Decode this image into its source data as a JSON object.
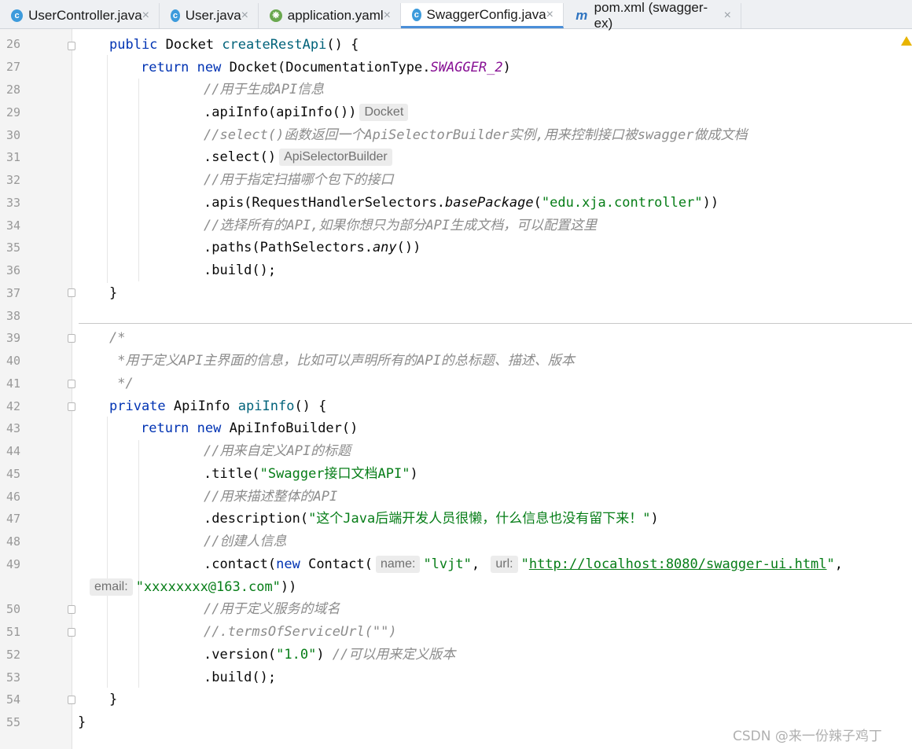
{
  "tabs": [
    {
      "label": "UserController.java",
      "icon": "java-class-icon",
      "close": "×"
    },
    {
      "label": "User.java",
      "icon": "java-class-icon",
      "close": "×"
    },
    {
      "label": "application.yaml",
      "icon": "spring-yaml-icon",
      "close": "×"
    },
    {
      "label": "SwaggerConfig.java",
      "icon": "java-class-icon",
      "close": "×",
      "active": true
    },
    {
      "label": "pom.xml (swagger-ex)",
      "icon": "maven-icon",
      "close": "×"
    }
  ],
  "line_numbers": [
    "26",
    "27",
    "28",
    "29",
    "30",
    "31",
    "32",
    "33",
    "34",
    "35",
    "36",
    "37",
    "38",
    "39",
    "40",
    "41",
    "42",
    "43",
    "44",
    "45",
    "46",
    "47",
    "48",
    "49",
    "50",
    "51",
    "52",
    "53",
    "54",
    "55"
  ],
  "code": {
    "l26": {
      "kw": "public ",
      "type": "Docket ",
      "fn": "createRestApi",
      "rest": "() {"
    },
    "l27": {
      "kw1": "return ",
      "kw2": "new ",
      "a": "Docket(DocumentationType.",
      "const": "SWAGGER_2",
      "b": ")"
    },
    "l28": {
      "comment": "//用于生成API信息"
    },
    "l29": {
      "code": ".apiInfo(apiInfo())",
      "hint": "Docket"
    },
    "l30": {
      "comment": "//select()函数返回一个ApiSelectorBuilder实例,用来控制接口被swagger做成文档"
    },
    "l31": {
      "code": ".select()",
      "hint": "ApiSelectorBuilder"
    },
    "l32": {
      "comment": "//用于指定扫描哪个包下的接口"
    },
    "l33": {
      "a": ".apis(RequestHandlerSelectors.",
      "it": "basePackage",
      "b": "(",
      "str": "\"edu.xja.controller\"",
      "c": "))"
    },
    "l34": {
      "comment": "//选择所有的API,如果你想只为部分API生成文档，可以配置这里"
    },
    "l35": {
      "a": ".paths(PathSelectors.",
      "it": "any",
      "b": "())"
    },
    "l36": {
      "code": ".build();"
    },
    "l37": {
      "code": "}"
    },
    "l39": {
      "comment": "/*"
    },
    "l40": {
      "comment": " *用于定义API主界面的信息，比如可以声明所有的API的总标题、描述、版本"
    },
    "l41": {
      "comment": " */"
    },
    "l42": {
      "kw": "private ",
      "type": "ApiInfo ",
      "fn": "apiInfo",
      "rest": "() {"
    },
    "l43": {
      "kw1": "return ",
      "kw2": "new ",
      "a": "ApiInfoBuilder()"
    },
    "l44": {
      "comment": "//用来自定义API的标题"
    },
    "l45": {
      "a": ".title(",
      "str": "\"Swagger接口文档API\"",
      "b": ")"
    },
    "l46": {
      "comment": "//用来描述整体的API"
    },
    "l47": {
      "a": ".description(",
      "str": "\"这个Java后端开发人员很懒，什么信息也没有留下来！\"",
      "b": ")"
    },
    "l48": {
      "comment": "//创建人信息"
    },
    "l49": {
      "a": ".contact(",
      "kw": "new ",
      "b": "Contact(",
      "hint1": "name:",
      "s1": "\"lvjt\"",
      "c": ", ",
      "hint2": "url:",
      "s2q": "\"",
      "url": "http://localhost:8080/swagger-ui.html",
      "s2e": "\"",
      "d": ","
    },
    "l49b": {
      "hint": "email:",
      "str": "\"xxxxxxxx@163.com\"",
      "b": "))"
    },
    "l50": {
      "comment": "//用于定义服务的域名"
    },
    "l51": {
      "comment": "//.termsOfServiceUrl(\"\")"
    },
    "l52": {
      "a": ".version(",
      "str": "\"1.0\"",
      "b": ") ",
      "comment": "//可以用来定义版本"
    },
    "l53": {
      "code": ".build();"
    },
    "l54": {
      "code": "}"
    },
    "l55": {
      "code": "}"
    }
  },
  "watermark": "CSDN @来一份辣子鸡丁"
}
